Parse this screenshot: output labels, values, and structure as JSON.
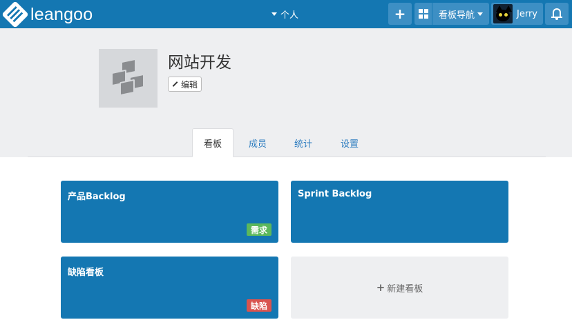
{
  "navbar": {
    "brand": "leangoo",
    "center_menu": "个人",
    "plus_label": "+",
    "board_nav_label": "看板导航",
    "user_name": "Jerry"
  },
  "project": {
    "title": "网站开发",
    "edit_label": "编辑"
  },
  "tabs": [
    {
      "label": "看板",
      "active": true
    },
    {
      "label": "成员",
      "active": false
    },
    {
      "label": "统计",
      "active": false
    },
    {
      "label": "设置",
      "active": false
    }
  ],
  "boards": [
    {
      "title": "产品Backlog",
      "tag": "需求",
      "tag_color": "#5cb85c"
    },
    {
      "title": "Sprint Backlog",
      "tag": "",
      "tag_color": ""
    },
    {
      "title": "缺陷看板",
      "tag": "缺陷",
      "tag_color": "#d9534f"
    }
  ],
  "new_board_label": "新建看板",
  "colors": {
    "primary": "#1477b2",
    "header_bg": "#eeeff1",
    "tag_green": "#5cb85c",
    "tag_red": "#d9534f"
  }
}
